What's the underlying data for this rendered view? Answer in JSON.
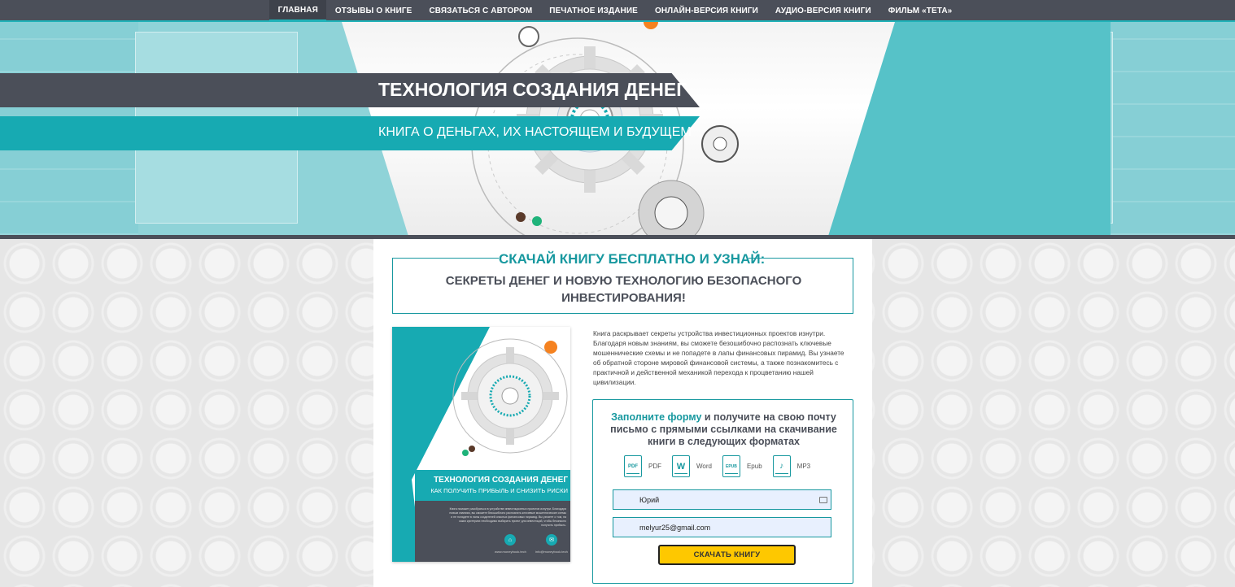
{
  "nav": {
    "items": [
      {
        "label": "ГЛАВНАЯ",
        "active": true
      },
      {
        "label": "ОТЗЫВЫ О КНИГЕ",
        "active": false
      },
      {
        "label": "СВЯЗАТЬСЯ С АВТОРОМ",
        "active": false
      },
      {
        "label": "ПЕЧАТНОЕ ИЗДАНИЕ",
        "active": false
      },
      {
        "label": "ОНЛАЙН-ВЕРСИЯ КНИГИ",
        "active": false
      },
      {
        "label": "АУДИО-ВЕРСИЯ КНИГИ",
        "active": false
      },
      {
        "label": "ФИЛЬМ «ТЕТА»",
        "active": false
      }
    ]
  },
  "hero": {
    "title": "ТЕХНОЛОГИЯ СОЗДАНИЯ ДЕНЕГ",
    "subtitle": "КНИГА О ДЕНЬГАХ, ИХ НАСТОЯЩЕМ И БУДУЩЕМ"
  },
  "headline": {
    "top": "СКАЧАЙ КНИГУ БЕСПЛАТНО И УЗНАЙ:",
    "bottom": "СЕКРЕТЫ ДЕНЕГ И НОВУЮ ТЕХНОЛОГИЮ БЕЗОПАСНОГО ИНВЕСТИРОВАНИЯ!"
  },
  "book": {
    "title": "ТЕХНОЛОГИЯ СОЗДАНИЯ ДЕНЕГ",
    "subtitle": "КАК ПОЛУЧИТЬ ПРИБЫЛЬ И СНИЗИТЬ РИСКИ",
    "blurb": "Книга поможет разобраться в устройстве инвестиционных проектов изнутри. Благодаря новым знаниям, вы сможете безошибочно распознать ключевые мошеннические схемы и не попадете в лапы создателей опасных финансовых пирамид. Вы узнаете о том, на каких критериях необходимо выбирать проект для инвестиций, чтобы безопасно получить прибыль.",
    "site": "www.moneybook.tech",
    "email": "info@moneybook.tech"
  },
  "description": "Книга раскрывает секреты устройства инвестиционных проектов изнутри. Благодаря новым знаниям, вы сможете безошибочно распознать ключевые мошеннические схемы и не попадете в лапы финансовых пирамид. Вы узнаете об обратной стороне мировой финансовой системы, а также познакомитесь с практичной и действенной механикой перехода к процветанию нашей цивилизации.",
  "form": {
    "heading_accent": "Заполните форму",
    "heading_rest": " и получите на свою почту письмо с прямыми ссылками на скачивание книги в следующих форматах",
    "formats": [
      {
        "icon": "PDF",
        "label": "PDF"
      },
      {
        "icon": "W",
        "label": "Word"
      },
      {
        "icon": "EPUB",
        "label": "Epub"
      },
      {
        "icon": "♪",
        "label": "MP3"
      }
    ],
    "name_value": "Юрий",
    "email_value": "melyur25@gmail.com",
    "submit_label": "СКАЧАТЬ КНИГУ"
  }
}
